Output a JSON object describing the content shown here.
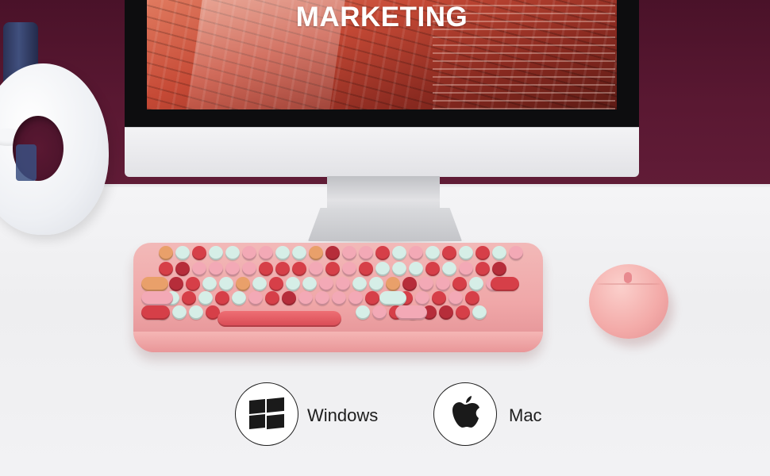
{
  "screen": {
    "title": "MARKETING"
  },
  "compatibility": [
    {
      "label": "Windows",
      "icon": "windows-logo-icon"
    },
    {
      "label": "Mac",
      "icon": "apple-logo-icon"
    }
  ],
  "colors": {
    "wall": "#5a1832",
    "desk": "#f1f1f3",
    "keyboard_body": "#f0a7a8",
    "key_red": "#d63f48",
    "key_pink": "#f3a9b6",
    "key_peach": "#e9a06a",
    "key_mint": "#d6eee7",
    "mouse": "#f3aaa8"
  }
}
